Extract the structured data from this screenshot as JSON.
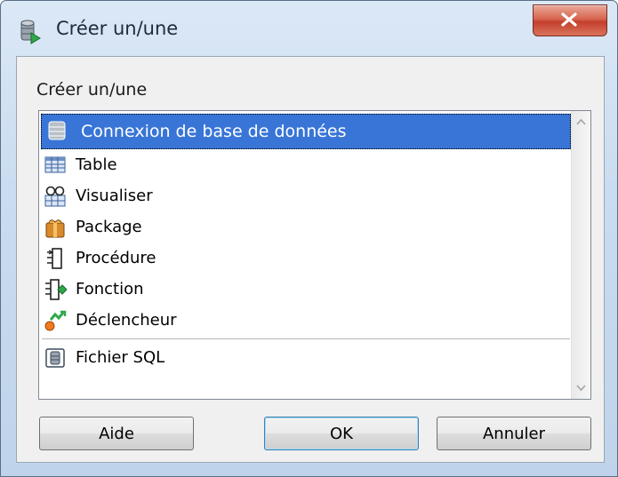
{
  "window": {
    "title": "Créer un/une"
  },
  "group": {
    "label": "Créer un/une"
  },
  "items": [
    {
      "label": "Connexion de base de données",
      "icon": "database-icon",
      "selected": true
    },
    {
      "label": "Table",
      "icon": "table-icon"
    },
    {
      "label": "Visualiser",
      "icon": "view-icon"
    },
    {
      "label": "Package",
      "icon": "package-icon"
    },
    {
      "label": "Procédure",
      "icon": "procedure-icon"
    },
    {
      "label": "Fonction",
      "icon": "function-icon"
    },
    {
      "label": "Déclencheur",
      "icon": "trigger-icon"
    },
    {
      "label": "Fichier SQL",
      "icon": "sql-file-icon"
    }
  ],
  "buttons": {
    "help": "Aide",
    "ok": "OK",
    "cancel": "Annuler"
  },
  "colors": {
    "selection": "#3875d7",
    "close": "#c4402c"
  }
}
